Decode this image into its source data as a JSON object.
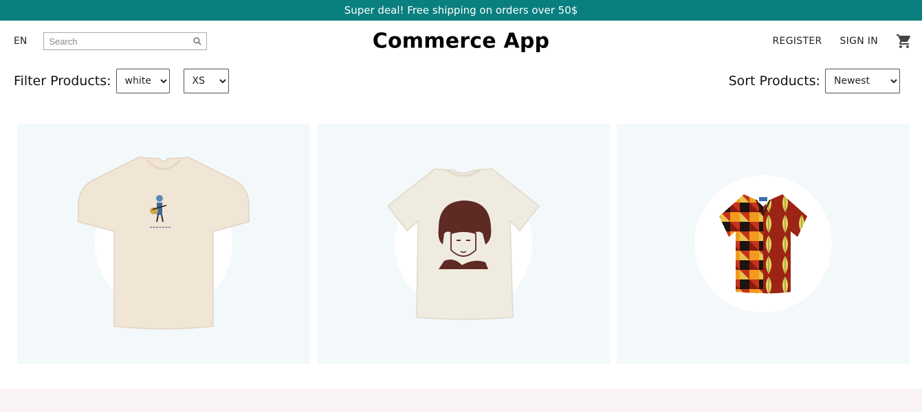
{
  "announcement": {
    "text": "Super deal! Free shipping on orders over 50$"
  },
  "navbar": {
    "language": "EN",
    "search": {
      "placeholder": "Search",
      "value": ""
    },
    "logo": "Commerce App",
    "register_label": "REGISTER",
    "signin_label": "SIGN IN"
  },
  "filters": {
    "filter_title": "Filter Products:",
    "color": {
      "selected": "white"
    },
    "size": {
      "selected": "XS"
    },
    "sort_title": "Sort Products:",
    "sort": {
      "selected": "Newest"
    }
  },
  "products": [
    {
      "image_icon": "tshirt-guitar-print-icon"
    },
    {
      "image_icon": "tshirt-portrait-print-icon"
    },
    {
      "image_icon": "patterned-shirt-icon"
    }
  ],
  "colors": {
    "announcement_bg": "#0a7f7f",
    "card_bg": "#f3f8fb",
    "footer_bg": "#fbf4f4"
  }
}
